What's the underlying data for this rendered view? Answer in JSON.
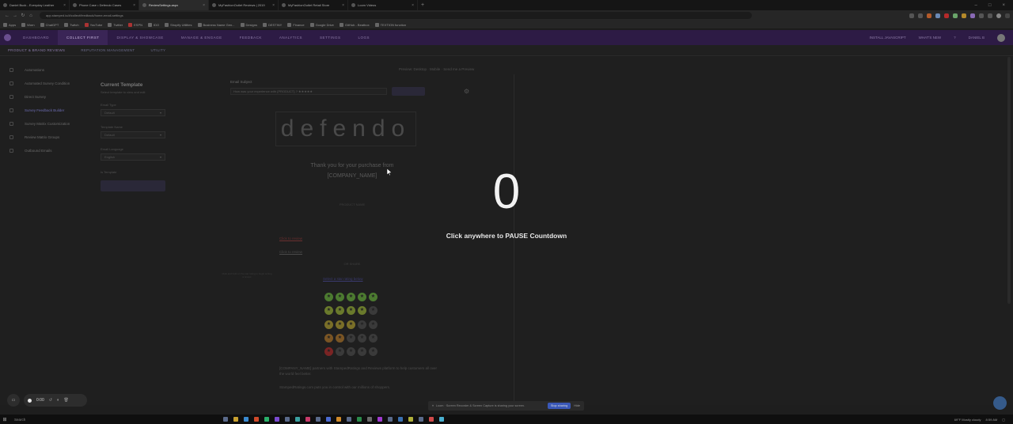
{
  "browser": {
    "tabs": [
      {
        "title": "Daniel Buck - Everyday Leather"
      },
      {
        "title": "Phone Case • Defendo Cases"
      },
      {
        "title": "ReviewSettings.aspx",
        "active": true
      },
      {
        "title": "MyFashionOutlet Reviews | 2019"
      },
      {
        "title": "MyFashionOutlet Retail Store"
      },
      {
        "title": "Loom Videos"
      }
    ],
    "url": "app.stamped.io/#/collect/feedback/home-email-settings",
    "bookmarks": [
      "Apps",
      "Worn",
      "ChatGPT",
      "Twitch",
      "YouTube",
      "Twitter",
      "ESPN",
      "IDO",
      "Shopify Utilities",
      "Business Name Gen...",
      "Designs",
      "DESTINY",
      "Finance",
      "Google Drive",
      "GitHub - Beatbox",
      "TEXTION function"
    ]
  },
  "app": {
    "nav": [
      "DASHBOARD",
      "COLLECT FIRST",
      "DISPLAY & SHOWCASE",
      "MANAGE & ENGAGE",
      "FEEDBACK",
      "ANALYTICS",
      "SETTINGS",
      "LOGS"
    ],
    "nav_active": "COLLECT FIRST",
    "nav_right": [
      "INSTALL JAVASCRIPT",
      "WHAT'S NEW",
      "?",
      "DANIEL B"
    ],
    "subnav": [
      "PRODUCT & BRAND REVIEWS",
      "REPUTATION MANAGEMENT",
      "UTILITY"
    ],
    "sidebar": [
      {
        "label": "Automations"
      },
      {
        "label": "Automated Survey Condition"
      },
      {
        "label": "Direct Survey"
      },
      {
        "label": "Survey Feedback Builder",
        "active": true
      },
      {
        "label": "Survey Matrix Customization"
      },
      {
        "label": "Review Matrix Groups"
      },
      {
        "label": "Outbound Emails"
      }
    ]
  },
  "template": {
    "title": "Current Template",
    "subtitle": "Select template to view and edit",
    "fields": [
      {
        "label": "Email Type",
        "value": "Default"
      },
      {
        "label": "Template Name",
        "value": "Default"
      },
      {
        "label": "Email Language",
        "value": "English"
      }
    ],
    "checkbox_label": "Is Template",
    "preview_links": "Preview: Desktop · Mobile · Send me a Preview"
  },
  "email": {
    "subject_label": "Email Subject",
    "subject_value": "How was your experience with {PRODUCT} ? ★★★★★",
    "brand_logo": "defendo",
    "thank_you": "Thank you for your purchase from",
    "company_token": "[COMPANY_NAME]",
    "small_line_1": "PRODUCT NAME",
    "link_red": "Click to review",
    "link_gray": "Click to review",
    "small_line_2": "OR SHARE",
    "note": "Click and hold on the star rating to begin writing a review",
    "link_blue": "Select a star rating below",
    "rating_rows": [
      [
        "#4c7a30",
        "#4c7a30",
        "#4c7a30",
        "#4c7a30",
        "#4c7a30"
      ],
      [
        "#6a7a2c",
        "#6a7a2c",
        "#6a7a2c",
        "#6a7a2c",
        "#3a3a3a"
      ],
      [
        "#7a6f28",
        "#7a6f28",
        "#7a6f28",
        "#3a3a3a",
        "#3a3a3a"
      ],
      [
        "#7a5524",
        "#7a5524",
        "#3a3a3a",
        "#3a3a3a",
        "#3a3a3a"
      ],
      [
        "#7a2424",
        "#3a3a3a",
        "#3a3a3a",
        "#3a3a3a",
        "#3a3a3a"
      ]
    ],
    "star_glyph": "★",
    "footer_1": "[COMPANY_NAME] partners with StampedRatings and Reviews platform to help customers all over the world feel better.",
    "footer_2": "StampedRatings.com puts you in control with our millions of shoppers."
  },
  "overlay": {
    "countdown": "0",
    "instruction": "Click anywhere to PAUSE Countdown"
  },
  "recorder": {
    "time": "0:00",
    "share_text": "Loom · Screen Recorder & Screen Capture is sharing your screen.",
    "stop_label": "Stop sharing",
    "hide_label": "Hide"
  },
  "taskbar": {
    "search": "Search",
    "weather": "69°F Mostly cloudy",
    "time": "8:59 AM"
  }
}
